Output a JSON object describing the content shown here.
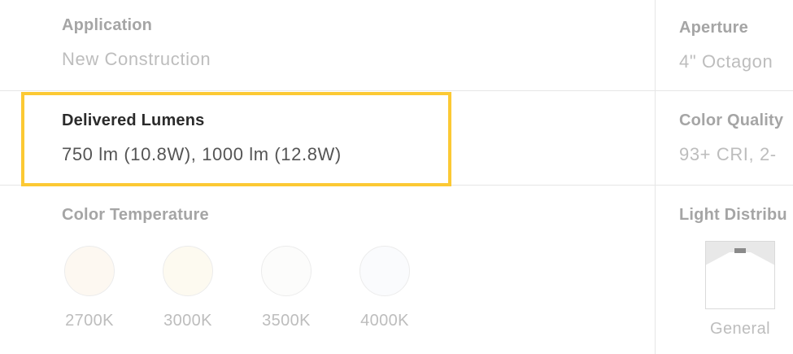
{
  "left": {
    "application": {
      "label": "Application",
      "value": "New Construction"
    },
    "delivered_lumens": {
      "label": "Delivered Lumens",
      "value": "750 lm (10.8W), 1000 lm (12.8W)"
    },
    "color_temperature": {
      "label": "Color Temperature",
      "swatches": [
        {
          "label": "2700K",
          "color": "#fdf8f1"
        },
        {
          "label": "3000K",
          "color": "#fdfaf0"
        },
        {
          "label": "3500K",
          "color": "#fcfcfb"
        },
        {
          "label": "4000K",
          "color": "#fafbfd"
        }
      ]
    }
  },
  "right": {
    "aperture": {
      "label": "Aperture",
      "value": "4\" Octagon"
    },
    "color_quality": {
      "label": "Color Quality",
      "value": "93+ CRI, 2-"
    },
    "light_distribution": {
      "label": "Light Distribu",
      "option_label": "General"
    }
  },
  "colors": {
    "highlight": "#fcc934",
    "muted_label": "#a5a5a5",
    "muted_value": "#bdbdbd",
    "active_label": "#2b2b2b",
    "active_value": "#555555",
    "divider": "#e6e6e6"
  },
  "icons": {
    "distribution": "general-beam-spread-icon"
  }
}
